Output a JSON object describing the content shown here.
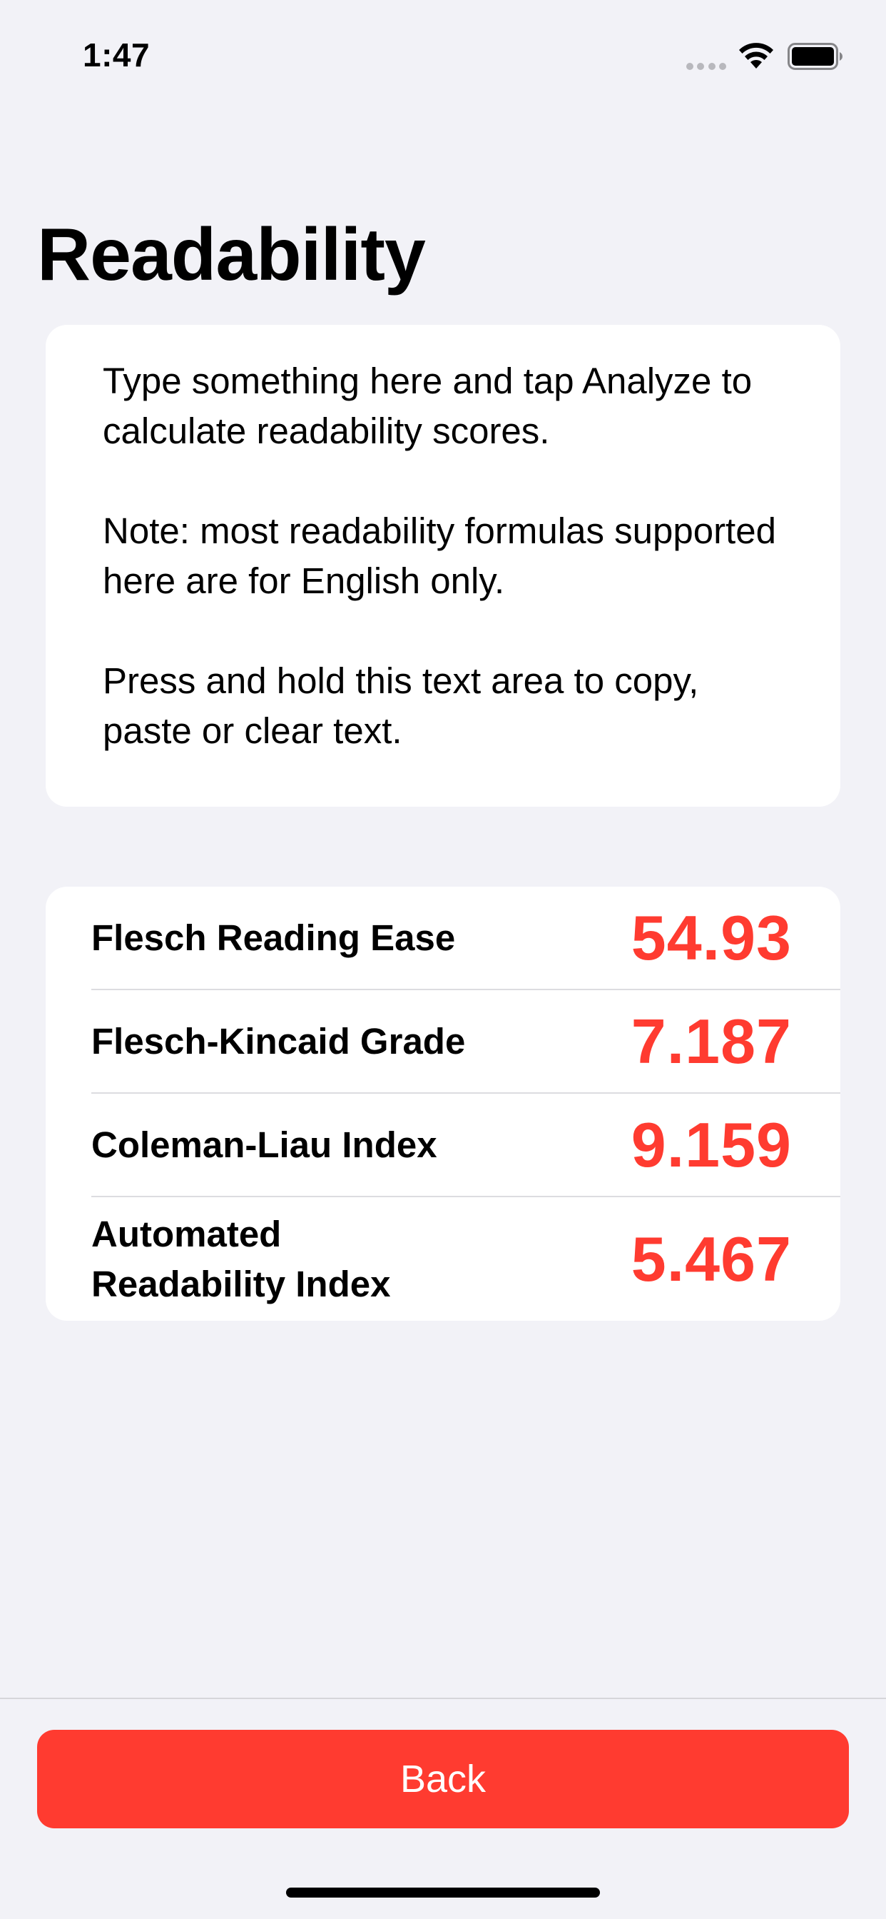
{
  "status_bar": {
    "time": "1:47",
    "icons": [
      "signal-dots-icon",
      "wifi-icon",
      "battery-icon"
    ]
  },
  "header": {
    "title": "Readability"
  },
  "text_area": {
    "paragraphs": [
      "Type something here and tap Analyze to calculate readability scores.",
      "Note: most readability formulas supported here are for English only.",
      "Press and hold this text area to copy, paste or clear text."
    ]
  },
  "scores": [
    {
      "label": "Flesch Reading Ease",
      "value": "54.93"
    },
    {
      "label": "Flesch-Kincaid Grade",
      "value": "7.187"
    },
    {
      "label": "Coleman-Liau Index",
      "value": "9.159"
    },
    {
      "label": "Automated Readability Index",
      "value": "5.467"
    }
  ],
  "footer": {
    "back_label": "Back"
  },
  "colors": {
    "accent": "#ff3b30",
    "background": "#f2f2f7",
    "card": "#ffffff"
  }
}
